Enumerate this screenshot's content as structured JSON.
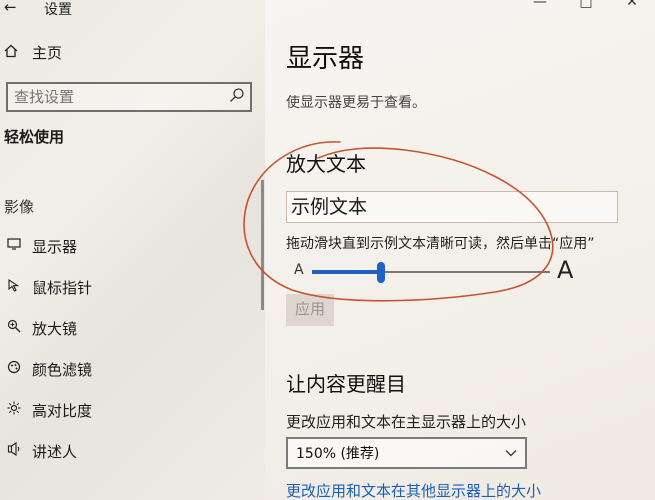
{
  "window": {
    "title": "设置",
    "controls": {
      "minimize": "—",
      "maximize": "□",
      "close": "✕"
    }
  },
  "sidebar": {
    "back": "←",
    "home": {
      "icon": "home-icon",
      "label": "主页"
    },
    "search": {
      "placeholder": "查找设置"
    },
    "section_title": "轻松使用",
    "group_label": "影像",
    "items": [
      {
        "icon": "monitor-icon",
        "label": "显示器"
      },
      {
        "icon": "pointer-icon",
        "label": "鼠标指针"
      },
      {
        "icon": "magnifier-icon",
        "label": "放大镜"
      },
      {
        "icon": "color-filter-icon",
        "label": "颜色滤镜"
      },
      {
        "icon": "contrast-icon",
        "label": "高对比度"
      },
      {
        "icon": "narrator-icon",
        "label": "讲述人"
      }
    ]
  },
  "main": {
    "title": "显示器",
    "subtitle": "使显示器更易于查看。",
    "enlarge_text": {
      "heading": "放大文本",
      "sample": "示例文本",
      "instruction": "拖动滑块直到示例文本清晰可读，然后单击“应用”",
      "small_a": "A",
      "big_a": "A",
      "slider_value": 0.29,
      "apply_label": "应用"
    },
    "everything_bigger": {
      "heading": "让内容更醒目",
      "scale_label": "更改应用和文本在主显示器上的大小",
      "scale_value": "150% (推荐)",
      "other_displays_link": "更改应用和文本在其他显示器上的大小"
    }
  },
  "annotation_color": "#c8532e"
}
